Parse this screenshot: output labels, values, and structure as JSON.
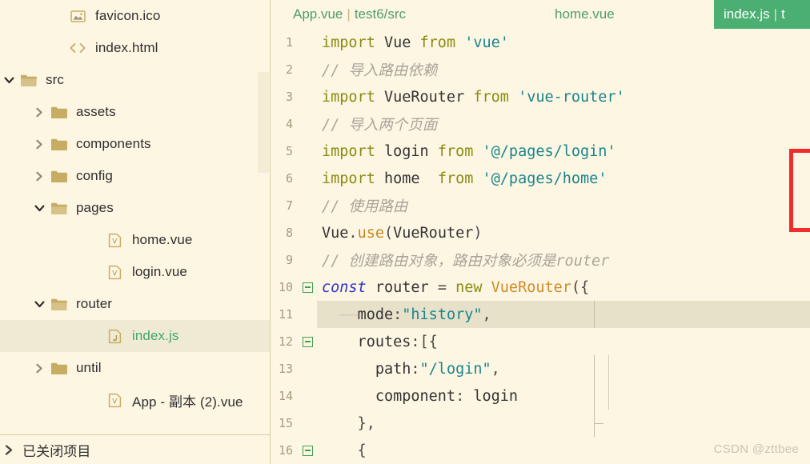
{
  "sidebar": {
    "tree": [
      {
        "label": "favicon.ico",
        "icon": "image-file-icon",
        "indent": 110,
        "twisty": "none",
        "selected": false
      },
      {
        "label": "index.html",
        "icon": "html-file-icon",
        "indent": 110,
        "twisty": "none",
        "selected": false
      },
      {
        "label": "src",
        "icon": "folder-open-icon",
        "indent": 42,
        "twisty": "down",
        "selected": false
      },
      {
        "label": "assets",
        "icon": "folder-icon",
        "indent": 86,
        "twisty": "right",
        "selected": false
      },
      {
        "label": "components",
        "icon": "folder-icon",
        "indent": 86,
        "twisty": "right",
        "selected": false
      },
      {
        "label": "config",
        "icon": "folder-icon",
        "indent": 86,
        "twisty": "right",
        "selected": false
      },
      {
        "label": "pages",
        "icon": "folder-open-icon",
        "indent": 86,
        "twisty": "down",
        "selected": false
      },
      {
        "label": "home.vue",
        "icon": "vue-file-icon",
        "indent": 156,
        "twisty": "none",
        "selected": false
      },
      {
        "label": "login.vue",
        "icon": "vue-file-icon",
        "indent": 156,
        "twisty": "none",
        "selected": false
      },
      {
        "label": "router",
        "icon": "folder-open-icon",
        "indent": 86,
        "twisty": "down",
        "selected": false
      },
      {
        "label": "index.js",
        "icon": "js-file-icon",
        "indent": 156,
        "twisty": "none",
        "selected": true
      },
      {
        "label": "until",
        "icon": "folder-icon",
        "indent": 86,
        "twisty": "right",
        "selected": false
      },
      {
        "label": "App - 副本 (2).vue",
        "icon": "vue-file-icon",
        "indent": 156,
        "twisty": "none",
        "selected": false
      }
    ],
    "closed_projects": {
      "label": "已关闭项目",
      "twisty": "right"
    }
  },
  "tabs": [
    {
      "name": "App.vue",
      "sep": "|",
      "path": "test6/src",
      "active": false
    },
    {
      "name": "home.vue",
      "sep": "",
      "path": "",
      "active": false
    },
    {
      "name": "index.js",
      "sep": "|",
      "path": "t",
      "active": true
    }
  ],
  "code": {
    "lines": [
      {
        "num": "1",
        "fold": "none",
        "guides": [],
        "tokens": [
          {
            "t": "import",
            "c": "k"
          },
          {
            "t": " ",
            "c": "pn"
          },
          {
            "t": "Vue",
            "c": "id"
          },
          {
            "t": " ",
            "c": "pn"
          },
          {
            "t": "from",
            "c": "k"
          },
          {
            "t": " ",
            "c": "pn"
          },
          {
            "t": "'vue'",
            "c": "str"
          }
        ]
      },
      {
        "num": "2",
        "fold": "none",
        "guides": [],
        "tokens": [
          {
            "t": "// 导入路由依赖",
            "c": "cm"
          }
        ]
      },
      {
        "num": "3",
        "fold": "none",
        "guides": [],
        "tokens": [
          {
            "t": "import",
            "c": "k"
          },
          {
            "t": " ",
            "c": "pn"
          },
          {
            "t": "VueRouter",
            "c": "id"
          },
          {
            "t": " ",
            "c": "pn"
          },
          {
            "t": "from",
            "c": "k"
          },
          {
            "t": " ",
            "c": "pn"
          },
          {
            "t": "'vue-router'",
            "c": "str"
          }
        ]
      },
      {
        "num": "4",
        "fold": "none",
        "guides": [],
        "tokens": [
          {
            "t": "// 导入两个页面",
            "c": "cm"
          }
        ]
      },
      {
        "num": "5",
        "fold": "none",
        "guides": [],
        "tokens": [
          {
            "t": "import",
            "c": "k"
          },
          {
            "t": " ",
            "c": "pn"
          },
          {
            "t": "login",
            "c": "id"
          },
          {
            "t": " ",
            "c": "pn"
          },
          {
            "t": "from",
            "c": "k"
          },
          {
            "t": " ",
            "c": "pn"
          },
          {
            "t": "'@/pages/login'",
            "c": "str"
          }
        ]
      },
      {
        "num": "6",
        "fold": "none",
        "guides": [],
        "tokens": [
          {
            "t": "import",
            "c": "k"
          },
          {
            "t": " ",
            "c": "pn"
          },
          {
            "t": "home",
            "c": "id"
          },
          {
            "t": "  ",
            "c": "pn"
          },
          {
            "t": "from",
            "c": "k"
          },
          {
            "t": " ",
            "c": "pn"
          },
          {
            "t": "'@/pages/home'",
            "c": "str"
          }
        ]
      },
      {
        "num": "7",
        "fold": "none",
        "guides": [],
        "tokens": [
          {
            "t": "// 使用路由",
            "c": "cm"
          }
        ]
      },
      {
        "num": "8",
        "fold": "none",
        "guides": [],
        "tokens": [
          {
            "t": "Vue",
            "c": "id"
          },
          {
            "t": ".",
            "c": "pn"
          },
          {
            "t": "use",
            "c": "fn"
          },
          {
            "t": "(",
            "c": "pn"
          },
          {
            "t": "VueRouter",
            "c": "id"
          },
          {
            "t": ")",
            "c": "pn"
          }
        ]
      },
      {
        "num": "9",
        "fold": "none",
        "guides": [],
        "tokens": [
          {
            "t": "// 创建路由对象，路由对象必须是router",
            "c": "cm"
          }
        ]
      },
      {
        "num": "10",
        "fold": "minus",
        "guides": [],
        "tokens": [
          {
            "t": "const",
            "c": "kw"
          },
          {
            "t": " ",
            "c": "pn"
          },
          {
            "t": "router",
            "c": "id"
          },
          {
            "t": " ",
            "c": "pn"
          },
          {
            "t": "=",
            "c": "pn"
          },
          {
            "t": " ",
            "c": "pn"
          },
          {
            "t": "new",
            "c": "k"
          },
          {
            "t": " ",
            "c": "pn"
          },
          {
            "t": "VueRouter",
            "c": "cls"
          },
          {
            "t": "({",
            "c": "pn"
          }
        ]
      },
      {
        "num": "11",
        "fold": "none",
        "guides": [
          "g1"
        ],
        "highlight": true,
        "tokens": [
          {
            "t": "  ——",
            "c": "ws"
          },
          {
            "t": "mode",
            "c": "id"
          },
          {
            "t": ":",
            "c": "pn"
          },
          {
            "t": "\"history\"",
            "c": "str"
          },
          {
            "t": ",",
            "c": "pn"
          }
        ]
      },
      {
        "num": "12",
        "fold": "minus",
        "guides": [],
        "tokens": [
          {
            "t": "    routes",
            "c": "id"
          },
          {
            "t": ":[{",
            "c": "pn"
          }
        ]
      },
      {
        "num": "13",
        "fold": "none",
        "guides": [
          "g1",
          "g2"
        ],
        "tokens": [
          {
            "t": "      path",
            "c": "id"
          },
          {
            "t": ":",
            "c": "pn"
          },
          {
            "t": "\"/login\"",
            "c": "str"
          },
          {
            "t": ",",
            "c": "pn"
          }
        ]
      },
      {
        "num": "14",
        "fold": "none",
        "guides": [
          "g1",
          "g2"
        ],
        "tokens": [
          {
            "t": "      component",
            "c": "id"
          },
          {
            "t": ": ",
            "c": "pn"
          },
          {
            "t": "login",
            "c": "id"
          }
        ]
      },
      {
        "num": "15",
        "fold": "none",
        "guides": [
          "g1"
        ],
        "stub": true,
        "tokens": [
          {
            "t": "    },",
            "c": "pn"
          }
        ]
      },
      {
        "num": "16",
        "fold": "minus",
        "guides": [],
        "tokens": [
          {
            "t": "    {",
            "c": "pn"
          }
        ]
      }
    ]
  },
  "annotation": {
    "type": "red-rectangle-highlight"
  },
  "watermark": {
    "text": "CSDN @zttbee"
  }
}
